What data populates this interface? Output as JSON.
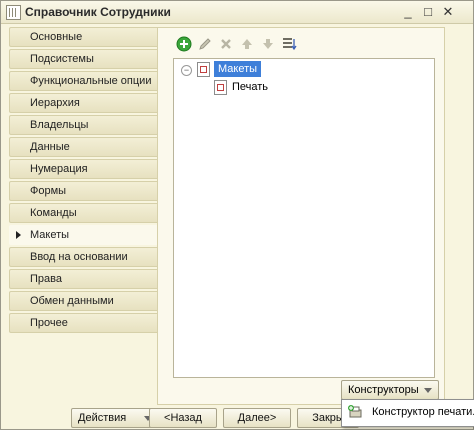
{
  "window": {
    "title": "Справочник Сотрудники",
    "controls": {
      "minimize": "_",
      "maximize": "□",
      "close": "✕"
    }
  },
  "sidebar": {
    "items": [
      {
        "label": "Основные",
        "active": false
      },
      {
        "label": "Подсистемы",
        "active": false
      },
      {
        "label": "Функциональные опции",
        "active": false
      },
      {
        "label": "Иерархия",
        "active": false
      },
      {
        "label": "Владельцы",
        "active": false
      },
      {
        "label": "Данные",
        "active": false
      },
      {
        "label": "Нумерация",
        "active": false
      },
      {
        "label": "Формы",
        "active": false
      },
      {
        "label": "Команды",
        "active": false
      },
      {
        "label": "Макеты",
        "active": true
      },
      {
        "label": "Ввод на основании",
        "active": false
      },
      {
        "label": "Права",
        "active": false
      },
      {
        "label": "Обмен данными",
        "active": false
      },
      {
        "label": "Прочее",
        "active": false
      }
    ]
  },
  "toolbar": {
    "icons": [
      "add-icon",
      "edit-icon",
      "delete-icon",
      "move-up-icon",
      "move-down-icon",
      "sort-list-icon"
    ]
  },
  "tree": {
    "root": {
      "label": "Макеты",
      "expanded": true,
      "selected": true
    },
    "children": [
      {
        "label": "Печать"
      }
    ]
  },
  "constructors_button": {
    "label": "Конструкторы"
  },
  "dropdown_menu": {
    "items": [
      {
        "label": "Конструктор печати..."
      }
    ]
  },
  "footer": {
    "actions_label": "Действия",
    "back_label": "<Назад",
    "next_label": "Далее>",
    "close_label": "Закры"
  },
  "colors": {
    "window_bg": "#f8f5df",
    "selection": "#3e7fd9",
    "tab_bg": "#ebe6c8"
  }
}
